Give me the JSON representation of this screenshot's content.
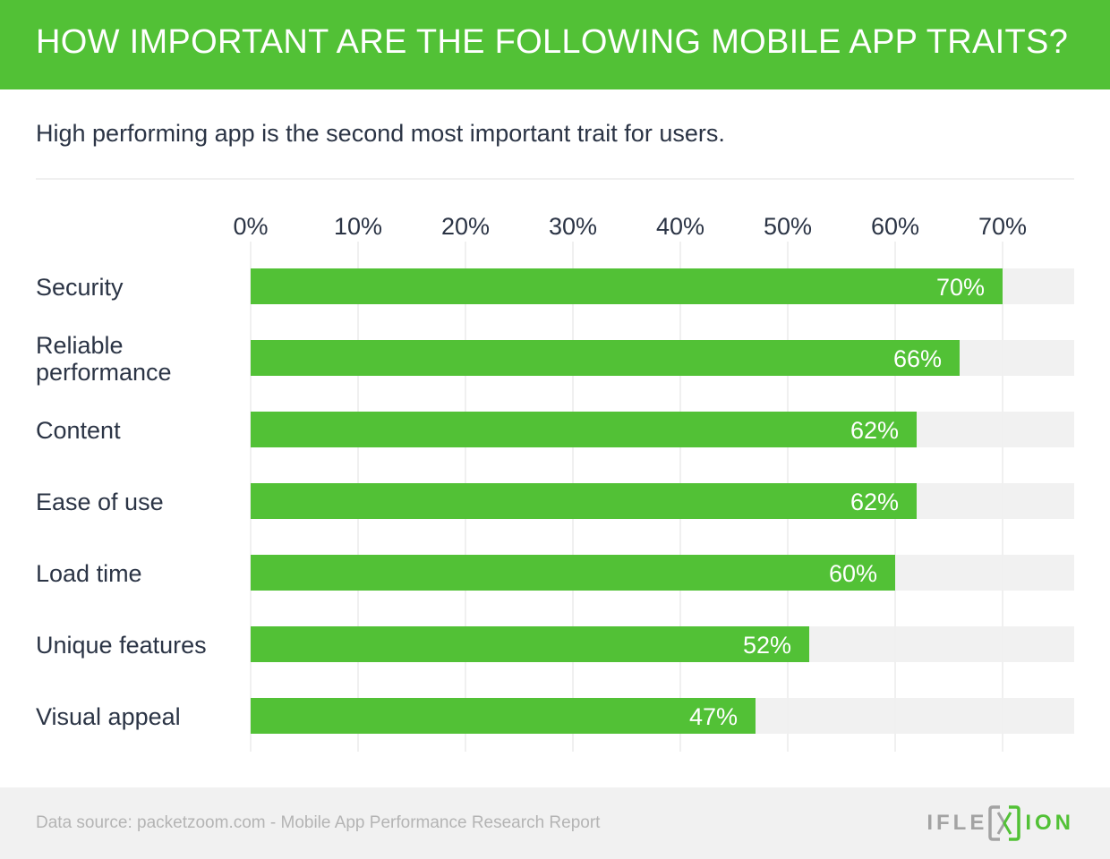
{
  "header": {
    "title": "HOW IMPORTANT ARE THE FOLLOWING MOBILE APP TRAITS?"
  },
  "subtitle": "High performing app is the second most important trait for users.",
  "colors": {
    "brand_green": "#52c136",
    "track_grey": "#f1f1f1",
    "grid_grey": "#f0f0f0",
    "text_dark": "#2b3445",
    "footer_text": "#b4b4b4",
    "logo_grey": "#a3a3a3"
  },
  "chart_data": {
    "type": "bar",
    "orientation": "horizontal",
    "title": "HOW IMPORTANT ARE THE FOLLOWING MOBILE APP TRAITS?",
    "subtitle": "High performing app is the second most important trait for users.",
    "categories": [
      "Security",
      "Reliable performance",
      "Content",
      "Ease of use",
      "Load time",
      "Unique features",
      "Visual appeal"
    ],
    "category_lines": [
      [
        "Security"
      ],
      [
        "Reliable",
        "performance"
      ],
      [
        "Content"
      ],
      [
        "Ease of use"
      ],
      [
        "Load time"
      ],
      [
        "Unique features"
      ],
      [
        "Visual appeal"
      ]
    ],
    "values": [
      70,
      66,
      62,
      62,
      60,
      52,
      47
    ],
    "value_labels": [
      "70%",
      "66%",
      "62%",
      "62%",
      "60%",
      "52%",
      "47%"
    ],
    "unit": "%",
    "xlim": [
      0,
      76.67
    ],
    "xticks": [
      0,
      10,
      20,
      30,
      40,
      50,
      60,
      70
    ],
    "xtick_labels": [
      "0%",
      "10%",
      "20%",
      "30%",
      "40%",
      "50%",
      "60%",
      "70%"
    ],
    "xaxis_position": "top",
    "grid": true,
    "legend": "none",
    "xlabel": "",
    "ylabel": ""
  },
  "footer": {
    "source": "Data source: packetzoom.com - Mobile App Performance Research Report",
    "logo_left": "IFLE",
    "logo_right": "ION"
  }
}
